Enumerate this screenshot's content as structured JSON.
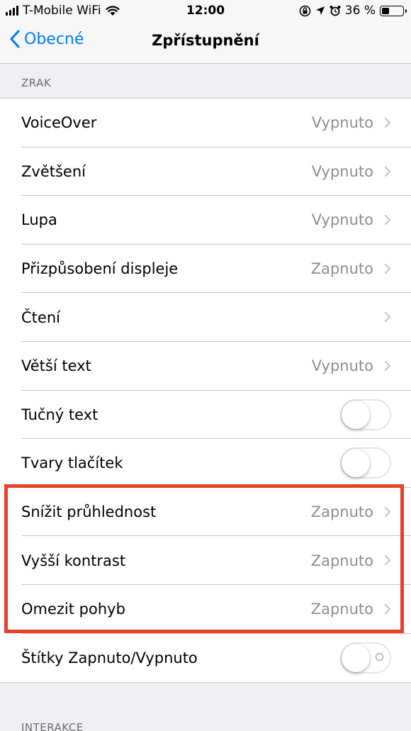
{
  "status_bar": {
    "carrier": "T-Mobile WiFi",
    "time": "12:00",
    "battery_percent": "36 %",
    "battery_level": 0.36
  },
  "nav": {
    "back_label": "Obecné",
    "title": "Zpřístupnění"
  },
  "sections": {
    "vision_header": "ZRAK",
    "interaction_header": "INTERAKCE"
  },
  "rows": [
    {
      "label": "VoiceOver",
      "value": "Vypnuto",
      "type": "disclosure"
    },
    {
      "label": "Zvětšení",
      "value": "Vypnuto",
      "type": "disclosure"
    },
    {
      "label": "Lupa",
      "value": "Vypnuto",
      "type": "disclosure"
    },
    {
      "label": "Přizpůsobení displeje",
      "value": "Zapnuto",
      "type": "disclosure"
    },
    {
      "label": "Čtení",
      "value": "",
      "type": "disclosure"
    },
    {
      "label": "Větší text",
      "value": "Vypnuto",
      "type": "disclosure"
    },
    {
      "label": "Tučný text",
      "value": "",
      "type": "toggle",
      "on": false
    },
    {
      "label": "Tvary tlačítek",
      "value": "",
      "type": "toggle",
      "on": false
    },
    {
      "label": "Snížit průhlednost",
      "value": "Zapnuto",
      "type": "disclosure"
    },
    {
      "label": "Vyšší kontrast",
      "value": "Zapnuto",
      "type": "disclosure"
    },
    {
      "label": "Omezit pohyb",
      "value": "Zapnuto",
      "type": "disclosure"
    },
    {
      "label": "Štítky Zapnuto/Vypnuto",
      "value": "",
      "type": "toggle",
      "on": false
    }
  ],
  "colors": {
    "accent": "#007aff",
    "highlight": "#e8402b",
    "secondary_text": "#8e8e93"
  }
}
